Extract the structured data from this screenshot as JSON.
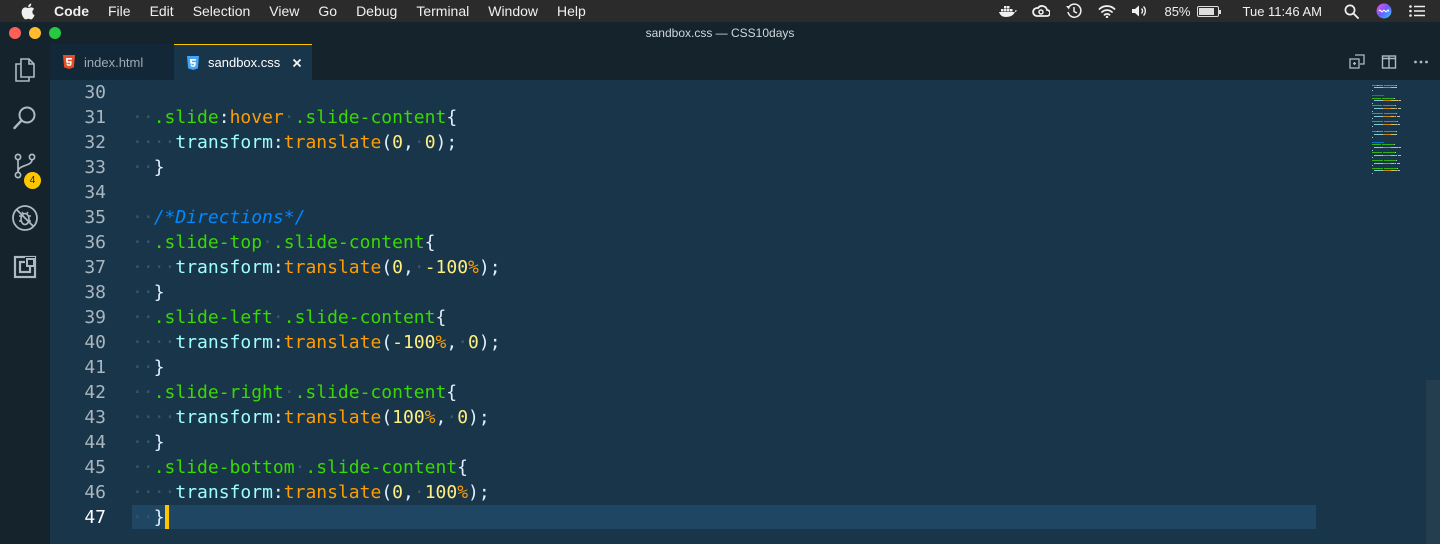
{
  "menubar": {
    "app": "Code",
    "items": [
      "File",
      "Edit",
      "Selection",
      "View",
      "Go",
      "Debug",
      "Terminal",
      "Window",
      "Help"
    ],
    "battery": "85%",
    "battery_level": 0.85,
    "clock": "Tue 11:46 AM"
  },
  "window": {
    "title": "sandbox.css — CSS10days"
  },
  "activity": {
    "scm_badge": "4"
  },
  "tabs": [
    {
      "label": "index.html",
      "icon": "html5-icon",
      "color": "#e44d26"
    },
    {
      "label": "sandbox.css",
      "icon": "css3-icon",
      "color": "#42a5f5",
      "active": true
    }
  ],
  "editor": {
    "lines": [
      {
        "n": "30",
        "tokens": []
      },
      {
        "n": "31",
        "tokens": [
          [
            "ws",
            "··"
          ],
          [
            "sel",
            ".slide"
          ],
          [
            "pn",
            ":"
          ],
          [
            "pseudo",
            "hover"
          ],
          [
            "ws",
            "·"
          ],
          [
            "sel",
            ".slide-content"
          ],
          [
            "pn",
            "{"
          ]
        ]
      },
      {
        "n": "32",
        "tokens": [
          [
            "ws",
            "··"
          ],
          [
            "ws",
            "··"
          ],
          [
            "prop",
            "transform"
          ],
          [
            "pn",
            ":"
          ],
          [
            "fn",
            "translate"
          ],
          [
            "pn",
            "("
          ],
          [
            "numv",
            "0"
          ],
          [
            "pn",
            ","
          ],
          [
            "ws",
            "·"
          ],
          [
            "numv",
            "0"
          ],
          [
            "pn",
            ");"
          ]
        ]
      },
      {
        "n": "33",
        "tokens": [
          [
            "ws",
            "··"
          ],
          [
            "pn",
            "}"
          ]
        ]
      },
      {
        "n": "34",
        "tokens": []
      },
      {
        "n": "35",
        "tokens": [
          [
            "ws",
            "··"
          ],
          [
            "cmt",
            "/*Directions*/"
          ]
        ]
      },
      {
        "n": "36",
        "tokens": [
          [
            "ws",
            "··"
          ],
          [
            "sel",
            ".slide-top"
          ],
          [
            "ws",
            "·"
          ],
          [
            "sel",
            ".slide-content"
          ],
          [
            "pn",
            "{"
          ]
        ]
      },
      {
        "n": "37",
        "tokens": [
          [
            "ws",
            "··"
          ],
          [
            "ws",
            "··"
          ],
          [
            "prop",
            "transform"
          ],
          [
            "pn",
            ":"
          ],
          [
            "fn",
            "translate"
          ],
          [
            "pn",
            "("
          ],
          [
            "numv",
            "0"
          ],
          [
            "pn",
            ","
          ],
          [
            "ws",
            "·"
          ],
          [
            "numv",
            "-100"
          ],
          [
            "pct",
            "%"
          ],
          [
            "pn",
            ");"
          ]
        ]
      },
      {
        "n": "38",
        "tokens": [
          [
            "ws",
            "··"
          ],
          [
            "pn",
            "}"
          ]
        ]
      },
      {
        "n": "39",
        "tokens": [
          [
            "ws",
            "··"
          ],
          [
            "sel",
            ".slide-left"
          ],
          [
            "ws",
            "·"
          ],
          [
            "sel",
            ".slide-content"
          ],
          [
            "pn",
            "{"
          ]
        ]
      },
      {
        "n": "40",
        "tokens": [
          [
            "ws",
            "··"
          ],
          [
            "ws",
            "··"
          ],
          [
            "prop",
            "transform"
          ],
          [
            "pn",
            ":"
          ],
          [
            "fn",
            "translate"
          ],
          [
            "pn",
            "("
          ],
          [
            "numv",
            "-100"
          ],
          [
            "pct",
            "%"
          ],
          [
            "pn",
            ","
          ],
          [
            "ws",
            "·"
          ],
          [
            "numv",
            "0"
          ],
          [
            "pn",
            ");"
          ]
        ]
      },
      {
        "n": "41",
        "tokens": [
          [
            "ws",
            "··"
          ],
          [
            "pn",
            "}"
          ]
        ]
      },
      {
        "n": "42",
        "tokens": [
          [
            "ws",
            "··"
          ],
          [
            "sel",
            ".slide-right"
          ],
          [
            "ws",
            "·"
          ],
          [
            "sel",
            ".slide-content"
          ],
          [
            "pn",
            "{"
          ]
        ]
      },
      {
        "n": "43",
        "tokens": [
          [
            "ws",
            "··"
          ],
          [
            "ws",
            "··"
          ],
          [
            "prop",
            "transform"
          ],
          [
            "pn",
            ":"
          ],
          [
            "fn",
            "translate"
          ],
          [
            "pn",
            "("
          ],
          [
            "numv",
            "100"
          ],
          [
            "pct",
            "%"
          ],
          [
            "pn",
            ","
          ],
          [
            "ws",
            "·"
          ],
          [
            "numv",
            "0"
          ],
          [
            "pn",
            ");"
          ]
        ]
      },
      {
        "n": "44",
        "tokens": [
          [
            "ws",
            "··"
          ],
          [
            "pn",
            "}"
          ]
        ]
      },
      {
        "n": "45",
        "tokens": [
          [
            "ws",
            "··"
          ],
          [
            "sel",
            ".slide-bottom"
          ],
          [
            "ws",
            "·"
          ],
          [
            "sel",
            ".slide-content"
          ],
          [
            "pn",
            "{"
          ]
        ]
      },
      {
        "n": "46",
        "tokens": [
          [
            "ws",
            "··"
          ],
          [
            "ws",
            "··"
          ],
          [
            "prop",
            "transform"
          ],
          [
            "pn",
            ":"
          ],
          [
            "fn",
            "translate"
          ],
          [
            "pn",
            "("
          ],
          [
            "numv",
            "0"
          ],
          [
            "pn",
            ","
          ],
          [
            "ws",
            "·"
          ],
          [
            "numv",
            "100"
          ],
          [
            "pct",
            "%"
          ],
          [
            "pn",
            ");"
          ]
        ]
      },
      {
        "n": "47",
        "tokens": [
          [
            "ws",
            "··"
          ],
          [
            "pn",
            "}"
          ]
        ]
      }
    ],
    "active_line": "47"
  },
  "colors": {
    "editor_bg": "#193549",
    "accent": "#ffc600",
    "selector": "#3ad900",
    "function": "#ff9d00",
    "property": "#9effff",
    "comment": "#0088ff"
  }
}
